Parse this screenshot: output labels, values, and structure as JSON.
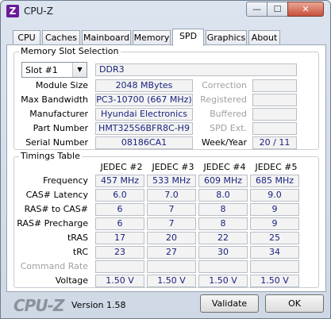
{
  "window": {
    "title": "CPU-Z",
    "icon_letter": "Z",
    "min_glyph": "—",
    "max_glyph": "☐",
    "close_glyph": "✕"
  },
  "tabs": [
    {
      "label": "CPU"
    },
    {
      "label": "Caches"
    },
    {
      "label": "Mainboard"
    },
    {
      "label": "Memory"
    },
    {
      "label": "SPD",
      "active": true
    },
    {
      "label": "Graphics"
    },
    {
      "label": "About"
    }
  ],
  "memory_slot": {
    "group_title": "Memory Slot Selection",
    "slot_value": "Slot #1",
    "type": "DDR3",
    "rows": [
      {
        "label": "Module Size",
        "value": "2048 MBytes",
        "right_label": "Correction",
        "right_value": ""
      },
      {
        "label": "Max Bandwidth",
        "value": "PC3-10700 (667 MHz)",
        "right_label": "Registered",
        "right_value": ""
      },
      {
        "label": "Manufacturer",
        "value": "Hyundai Electronics",
        "right_label": "Buffered",
        "right_value": ""
      },
      {
        "label": "Part Number",
        "value": "HMT325S6BFR8C-H9",
        "right_label": "SPD Ext.",
        "right_value": ""
      },
      {
        "label": "Serial Number",
        "value": "08186CA1",
        "right_label": "Week/Year",
        "right_value": "20 / 11"
      }
    ]
  },
  "timings": {
    "group_title": "Timings Table",
    "columns": [
      "JEDEC #2",
      "JEDEC #3",
      "JEDEC #4",
      "JEDEC #5"
    ],
    "rows": [
      {
        "label": "Frequency",
        "values": [
          "457 MHz",
          "533 MHz",
          "609 MHz",
          "685 MHz"
        ]
      },
      {
        "label": "CAS# Latency",
        "values": [
          "6.0",
          "7.0",
          "8.0",
          "9.0"
        ]
      },
      {
        "label": "RAS# to CAS#",
        "values": [
          "6",
          "7",
          "8",
          "9"
        ]
      },
      {
        "label": "RAS# Precharge",
        "values": [
          "6",
          "7",
          "8",
          "9"
        ]
      },
      {
        "label": "tRAS",
        "values": [
          "17",
          "20",
          "22",
          "25"
        ]
      },
      {
        "label": "tRC",
        "values": [
          "23",
          "27",
          "30",
          "34"
        ]
      },
      {
        "label": "Command Rate",
        "values": [
          "",
          "",
          "",
          ""
        ]
      },
      {
        "label": "Voltage",
        "values": [
          "1.50 V",
          "1.50 V",
          "1.50 V",
          "1.50 V"
        ]
      }
    ]
  },
  "footer": {
    "logo": "CPU-Z",
    "version": "Version 1.58",
    "validate_label": "Validate",
    "ok_label": "OK"
  }
}
